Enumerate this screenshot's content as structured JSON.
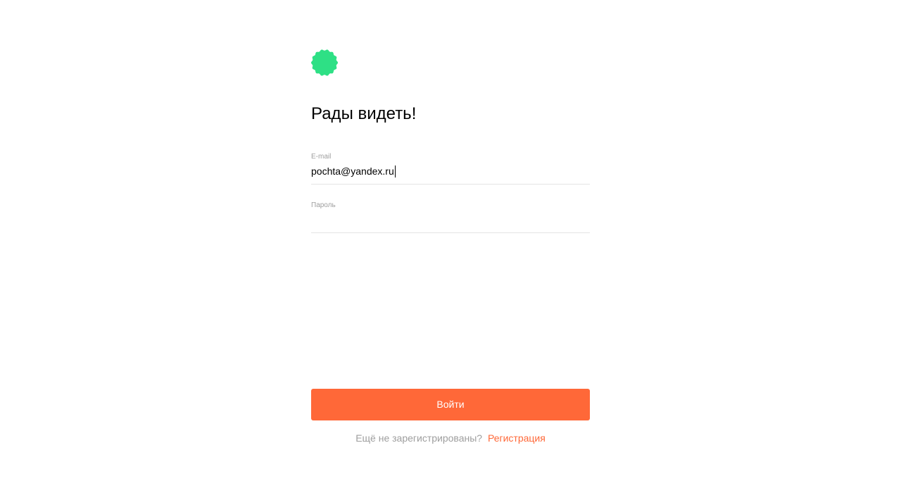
{
  "colors": {
    "logo": "#2ee085",
    "accent": "#ff6838",
    "muted_text": "#9e9e9e",
    "divider": "#e4e4e4"
  },
  "logo": {
    "icon": "green-flower-badge-icon"
  },
  "title": "Рады видеть!",
  "email": {
    "label": "E-mail",
    "value": "pochta@yandex.ru"
  },
  "password": {
    "label": "Пароль",
    "value": ""
  },
  "submit_label": "Войти",
  "footer": {
    "question": "Ещё не зарегистрированы?",
    "link_label": "Регистрация"
  }
}
